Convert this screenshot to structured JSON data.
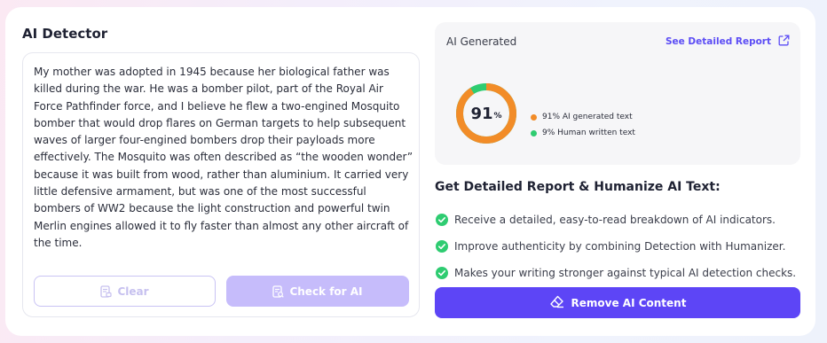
{
  "detector": {
    "title": "AI Detector",
    "text": "My mother was adopted in 1945 because her biological father was killed during the war. He was a bomber pilot, part of the Royal Air Force Pathfinder force, and I believe he flew a two-engined Mosquito bomber that would drop flares on German targets to help subsequent waves of larger four-engined bombers drop their payloads more effectively. The Mosquito was often described as “the wooden wonder” because it was built from wood, rather than aluminium. It carried very little defensive armament, but was one of the most successful bombers of WW2 because the light construction and powerful twin Merlin engines allowed it to fly faster than almost any other aircraft of the time.",
    "clear_label": "Clear",
    "check_label": "Check for AI",
    "clear_icon": "document-eraser-icon",
    "check_icon": "document-scan-icon"
  },
  "result": {
    "label": "AI Generated",
    "link_label": "See Detailed Report",
    "link_icon": "external-link-icon",
    "score": "91",
    "score_unit": "%",
    "ai_fraction": 0.91,
    "legend": [
      {
        "label": "91% AI generated text",
        "color": "#f28c28"
      },
      {
        "label": "9% Human written text",
        "color": "#2ecc71"
      }
    ]
  },
  "report": {
    "title": "Get Detailed Report & Humanize AI Text:",
    "features": [
      "Receive a detailed, easy-to-read breakdown of AI indicators.",
      "Improve authenticity by combining Detection with Humanizer.",
      "Makes your writing stronger against typical AI detection checks."
    ],
    "button_label": "Remove AI Content",
    "button_icon": "eraser-icon"
  },
  "colors": {
    "accent": "#5d45f6",
    "ai": "#f28c28",
    "human": "#2ecc71",
    "check_green": "#2ecc71"
  }
}
